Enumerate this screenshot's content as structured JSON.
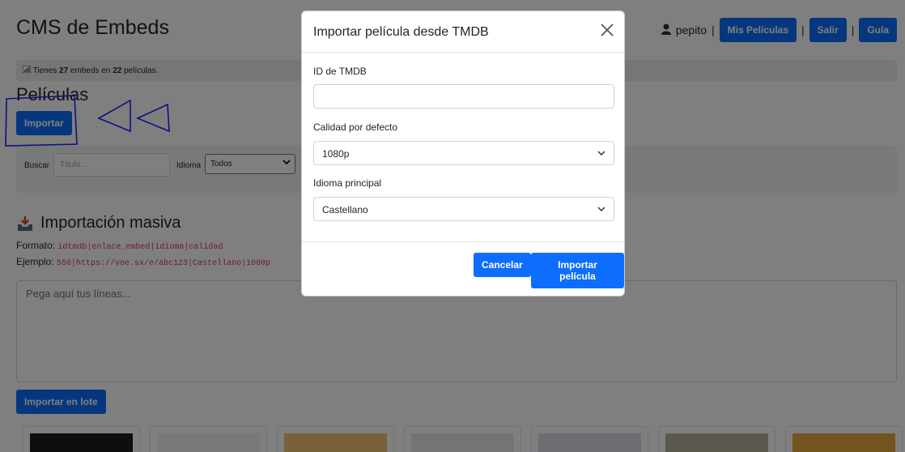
{
  "app": {
    "title": "CMS de Embeds"
  },
  "header": {
    "username": "pepito",
    "separator": "|",
    "nav": [
      {
        "label": "Mis Películas"
      },
      {
        "label": "Salir"
      },
      {
        "label": "Guía"
      }
    ]
  },
  "stats": {
    "prefix": "Tienes ",
    "embeds": "27",
    "middle": " embeds en ",
    "movies": "22",
    "suffix": " películas."
  },
  "movies": {
    "heading": "Películas",
    "import_label": "Importar"
  },
  "filters": {
    "search_label": "Buscar",
    "search_placeholder": "Título...",
    "language_label": "Idioma",
    "language_value": "Todos"
  },
  "mass_import": {
    "heading": "Importación masiva",
    "format_label": "Formato:",
    "format_code": "idtmdb|enlace_embed|idioma|calidad",
    "example_label": "Ejemplo:",
    "example_code": "550|https://voe.sx/e/abc123|Castellano|1080p",
    "textarea_placeholder": "Pega aquí tus líneas...",
    "submit_label": "Importar en lote"
  },
  "modal": {
    "title": "Importar película desde TMDB",
    "tmdb_label": "ID de TMDB",
    "tmdb_value": "",
    "quality_label": "Calidad por defecto",
    "quality_value": "1080p",
    "language_label": "Idioma principal",
    "language_value": "Castellano",
    "cancel_label": "Cancelar",
    "confirm_label": "Importar película"
  },
  "colors": {
    "primary": "#0d6efd",
    "annotation": "#1a24ff",
    "code": "#d63384"
  }
}
